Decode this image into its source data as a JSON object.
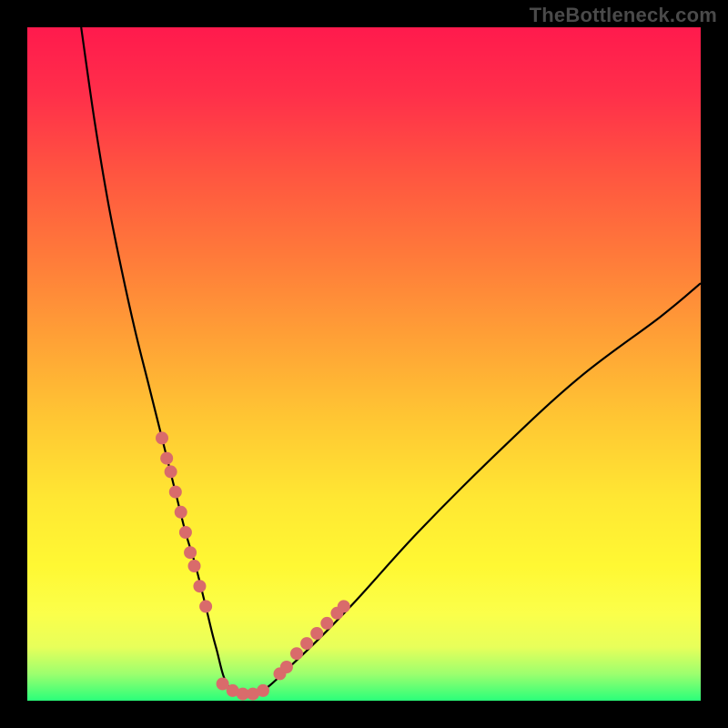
{
  "watermark": "TheBottleneck.com",
  "colors": {
    "background": "#000000",
    "gradient_top": "#ff1a4d",
    "gradient_bottom": "#2aff7a",
    "curve": "#000000",
    "dot": "#d96b6b"
  },
  "chart_data": {
    "type": "line",
    "title": "",
    "xlabel": "",
    "ylabel": "",
    "xlim": [
      0,
      100
    ],
    "ylim": [
      0,
      100
    ],
    "grid": false,
    "legend": false,
    "series": [
      {
        "name": "bottleneck-curve",
        "x": [
          8,
          10,
          12,
          14,
          16,
          18,
          20,
          22,
          23.5,
          25,
          26.5,
          28,
          30,
          34,
          40,
          48,
          58,
          70,
          82,
          94,
          100
        ],
        "y": [
          100,
          86,
          74,
          64,
          55,
          47,
          39,
          31,
          25,
          20,
          14,
          8,
          2,
          1,
          6,
          14,
          25,
          37,
          48,
          57,
          62
        ]
      }
    ],
    "markers": [
      {
        "name": "left-cluster",
        "points": [
          {
            "x": 20.0,
            "y": 39
          },
          {
            "x": 20.7,
            "y": 36
          },
          {
            "x": 21.3,
            "y": 34
          },
          {
            "x": 22.0,
            "y": 31
          },
          {
            "x": 22.8,
            "y": 28
          },
          {
            "x": 23.5,
            "y": 25
          },
          {
            "x": 24.2,
            "y": 22
          },
          {
            "x": 24.8,
            "y": 20
          },
          {
            "x": 25.6,
            "y": 17
          },
          {
            "x": 26.5,
            "y": 14
          }
        ]
      },
      {
        "name": "bottom-cluster",
        "points": [
          {
            "x": 29.0,
            "y": 2.5
          },
          {
            "x": 30.5,
            "y": 1.5
          },
          {
            "x": 32.0,
            "y": 1.0
          },
          {
            "x": 33.5,
            "y": 1.0
          },
          {
            "x": 35.0,
            "y": 1.5
          }
        ]
      },
      {
        "name": "right-cluster",
        "points": [
          {
            "x": 37.5,
            "y": 4
          },
          {
            "x": 38.5,
            "y": 5
          },
          {
            "x": 40.0,
            "y": 7
          },
          {
            "x": 41.5,
            "y": 8.5
          },
          {
            "x": 43.0,
            "y": 10
          },
          {
            "x": 44.5,
            "y": 11.5
          },
          {
            "x": 46.0,
            "y": 13
          },
          {
            "x": 47.0,
            "y": 14
          }
        ]
      }
    ]
  }
}
